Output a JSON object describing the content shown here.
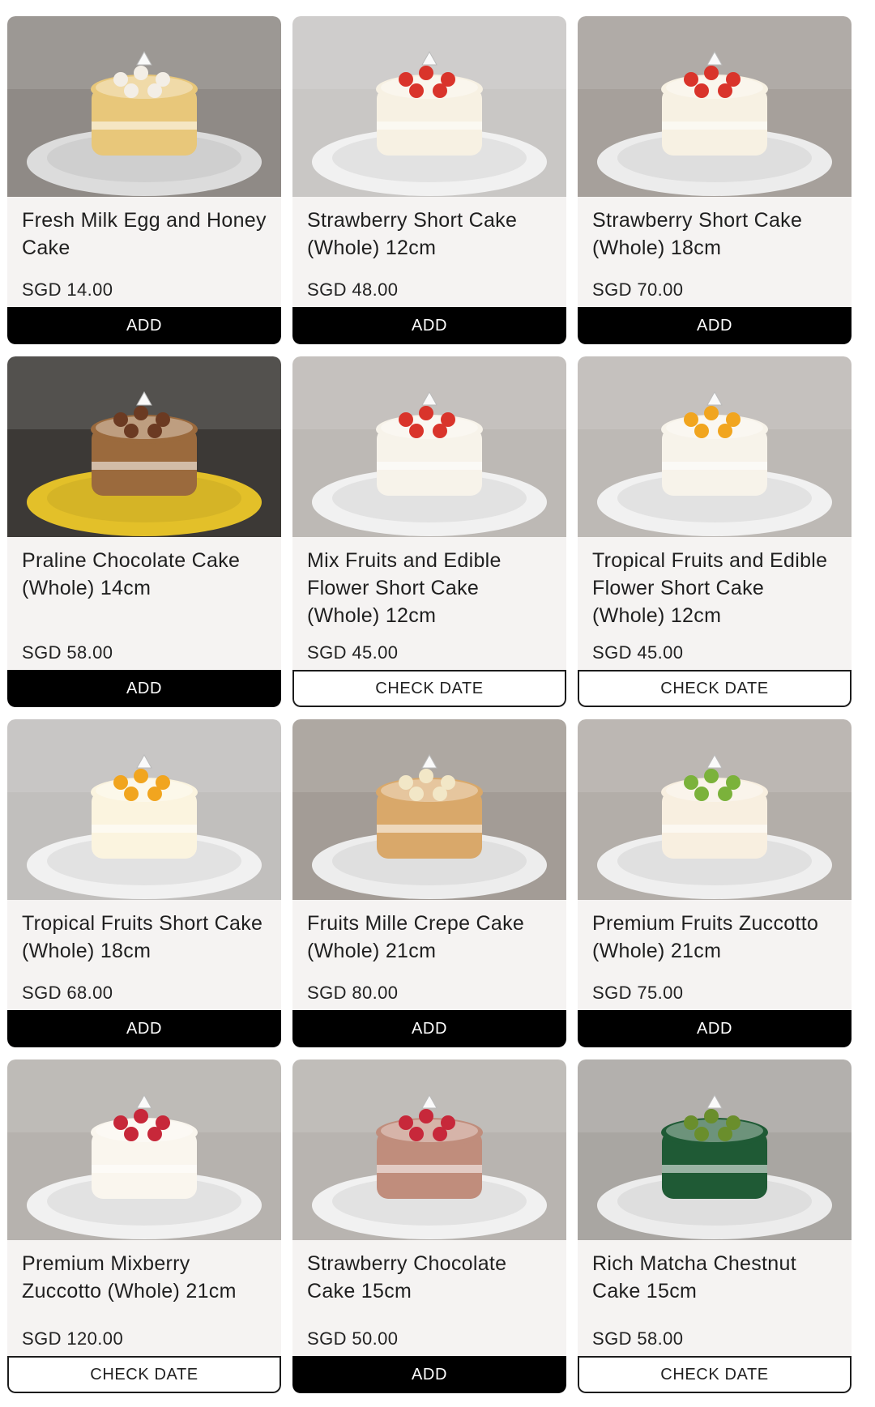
{
  "products": [
    {
      "name": "Fresh Milk Egg and Honey Cake",
      "price": "SGD 14.00",
      "action": "ADD",
      "action_type": "add",
      "bg": "#8f8a86",
      "plate": "#dcdcdc",
      "cake": "#e8c77a",
      "accent": "#f3eee6"
    },
    {
      "name": "Strawberry Short Cake (Whole) 12cm",
      "price": "SGD 48.00",
      "action": "ADD",
      "action_type": "add",
      "bg": "#c9c7c5",
      "plate": "#f1f1f1",
      "cake": "#f7f1e3",
      "accent": "#d9342b"
    },
    {
      "name": "Strawberry Short Cake (Whole) 18cm",
      "price": "SGD 70.00",
      "action": "ADD",
      "action_type": "add",
      "bg": "#a6a09b",
      "plate": "#ececec",
      "cake": "#f7f1e3",
      "accent": "#d9342b"
    },
    {
      "name": "Praline Chocolate Cake (Whole) 14cm",
      "price": "SGD 58.00",
      "action": "ADD",
      "action_type": "add",
      "bg": "#3c3936",
      "plate": "#e3c029",
      "cake": "#9b6a3d",
      "accent": "#6b3a22"
    },
    {
      "name": "Mix Fruits and Edible Flower Short Cake (Whole) 12cm",
      "price": "SGD 45.00",
      "action": "CHECK DATE",
      "action_type": "check",
      "bg": "#bdb9b5",
      "plate": "#f1f1f1",
      "cake": "#f7f3ea",
      "accent": "#d9342b"
    },
    {
      "name": "Tropical Fruits and Edible Flower Short Cake (Whole) 12cm",
      "price": "SGD 45.00",
      "action": "CHECK DATE",
      "action_type": "check",
      "bg": "#bdb9b5",
      "plate": "#f1f1f1",
      "cake": "#f7f3ea",
      "accent": "#f1a51f"
    },
    {
      "name": "Tropical Fruits Short Cake (Whole) 18cm",
      "price": "SGD 68.00",
      "action": "ADD",
      "action_type": "add",
      "bg": "#c1bfbd",
      "plate": "#f1f1f1",
      "cake": "#fbf4df",
      "accent": "#f1a51f"
    },
    {
      "name": "Fruits Mille Crepe Cake (Whole) 21cm",
      "price": "SGD 80.00",
      "action": "ADD",
      "action_type": "add",
      "bg": "#a39c96",
      "plate": "#ededed",
      "cake": "#d9a86a",
      "accent": "#f2e7c7"
    },
    {
      "name": "Premium Fruits Zuccotto (Whole) 21cm",
      "price": "SGD 75.00",
      "action": "ADD",
      "action_type": "add",
      "bg": "#b3aea9",
      "plate": "#efefef",
      "cake": "#f8efe0",
      "accent": "#7bb23b"
    },
    {
      "name": "Premium Mixberry Zuccotto (Whole) 21cm",
      "price": "SGD 120.00",
      "action": "CHECK DATE",
      "action_type": "check",
      "bg": "#b6b2ae",
      "plate": "#f1f1f1",
      "cake": "#faf6ee",
      "accent": "#c7283a"
    },
    {
      "name": "Strawberry Chocolate Cake 15cm",
      "price": "SGD 50.00",
      "action": "ADD",
      "action_type": "add",
      "bg": "#b8b4b0",
      "plate": "#f1f1f1",
      "cake": "#c08d7c",
      "accent": "#c7283a"
    },
    {
      "name": "Rich Matcha Chestnut Cake 15cm",
      "price": "SGD 58.00",
      "action": "CHECK DATE",
      "action_type": "check",
      "bg": "#a9a6a2",
      "plate": "#ececec",
      "cake": "#1f5a35",
      "accent": "#6a8e2c"
    }
  ]
}
